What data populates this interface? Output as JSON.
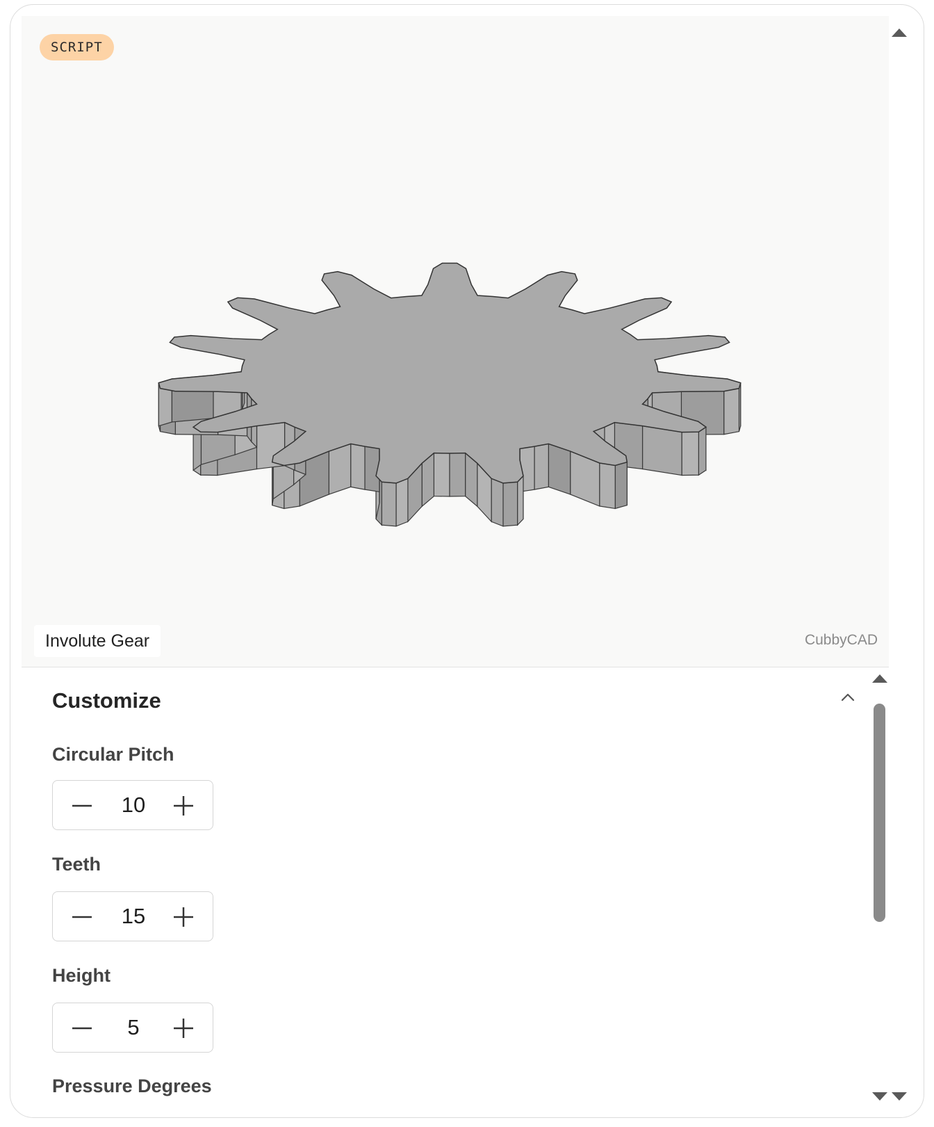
{
  "viewer": {
    "badge": "SCRIPT",
    "model_title": "Involute Gear",
    "brand": "CubbyCAD",
    "gear_teeth": 15,
    "gear_color": "#aaaaaa"
  },
  "customize": {
    "title": "Customize",
    "fields": [
      {
        "label": "Circular Pitch",
        "value": "10"
      },
      {
        "label": "Teeth",
        "value": "15"
      },
      {
        "label": "Height",
        "value": "5"
      },
      {
        "label": "Pressure Degrees"
      }
    ]
  },
  "icons": {
    "collapse": "chevron-up-icon",
    "decrement": "minus-icon",
    "increment": "plus-icon"
  }
}
